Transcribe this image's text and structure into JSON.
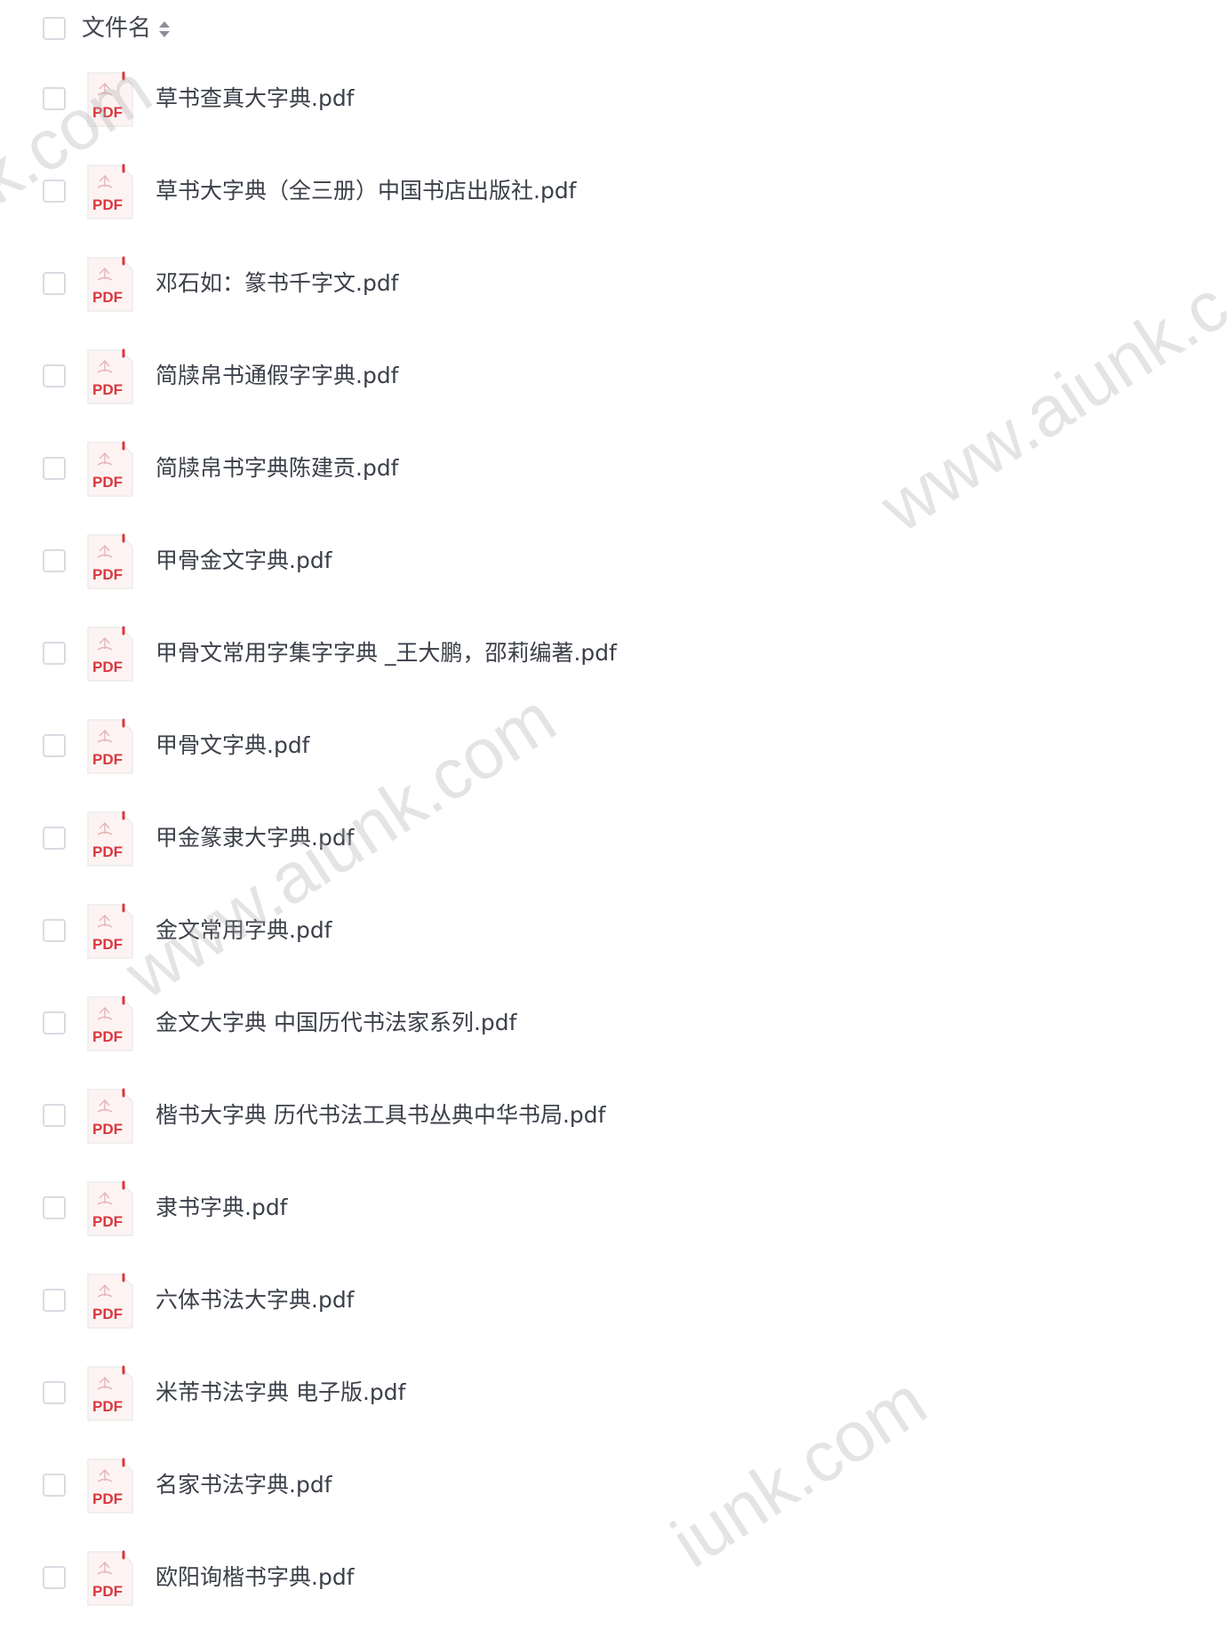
{
  "header": {
    "column_label": "文件名",
    "sort_icon": "sort-updown-icon"
  },
  "file_icon": {
    "name": "pdf-file-icon",
    "label": "PDF",
    "accent_color": "#d9383e"
  },
  "files": [
    "草书查真大字典.pdf",
    "草书大字典（全三册）中国书店出版社.pdf",
    "邓石如：篆书千字文.pdf",
    "简牍帛书通假字字典.pdf",
    "简牍帛书字典陈建贡.pdf",
    "甲骨金文字典.pdf",
    "甲骨文常用字集字字典 _王大鹏，邵莉编著.pdf",
    "甲骨文字典.pdf",
    "甲金篆隶大字典.pdf",
    "金文常用字典.pdf",
    "金文大字典 中国历代书法家系列.pdf",
    "楷书大字典 历代书法工具书丛典中华书局.pdf",
    "隶书字典.pdf",
    "六体书法大字典.pdf",
    "米芾书法字典 电子版.pdf",
    "名家书法字典.pdf",
    "欧阳询楷书字典.pdf"
  ],
  "watermark": {
    "text_1": "nk.com",
    "text_2": "www.aiunk.c",
    "text_3": "www.aiunk.com",
    "text_4": "iunk.com"
  }
}
